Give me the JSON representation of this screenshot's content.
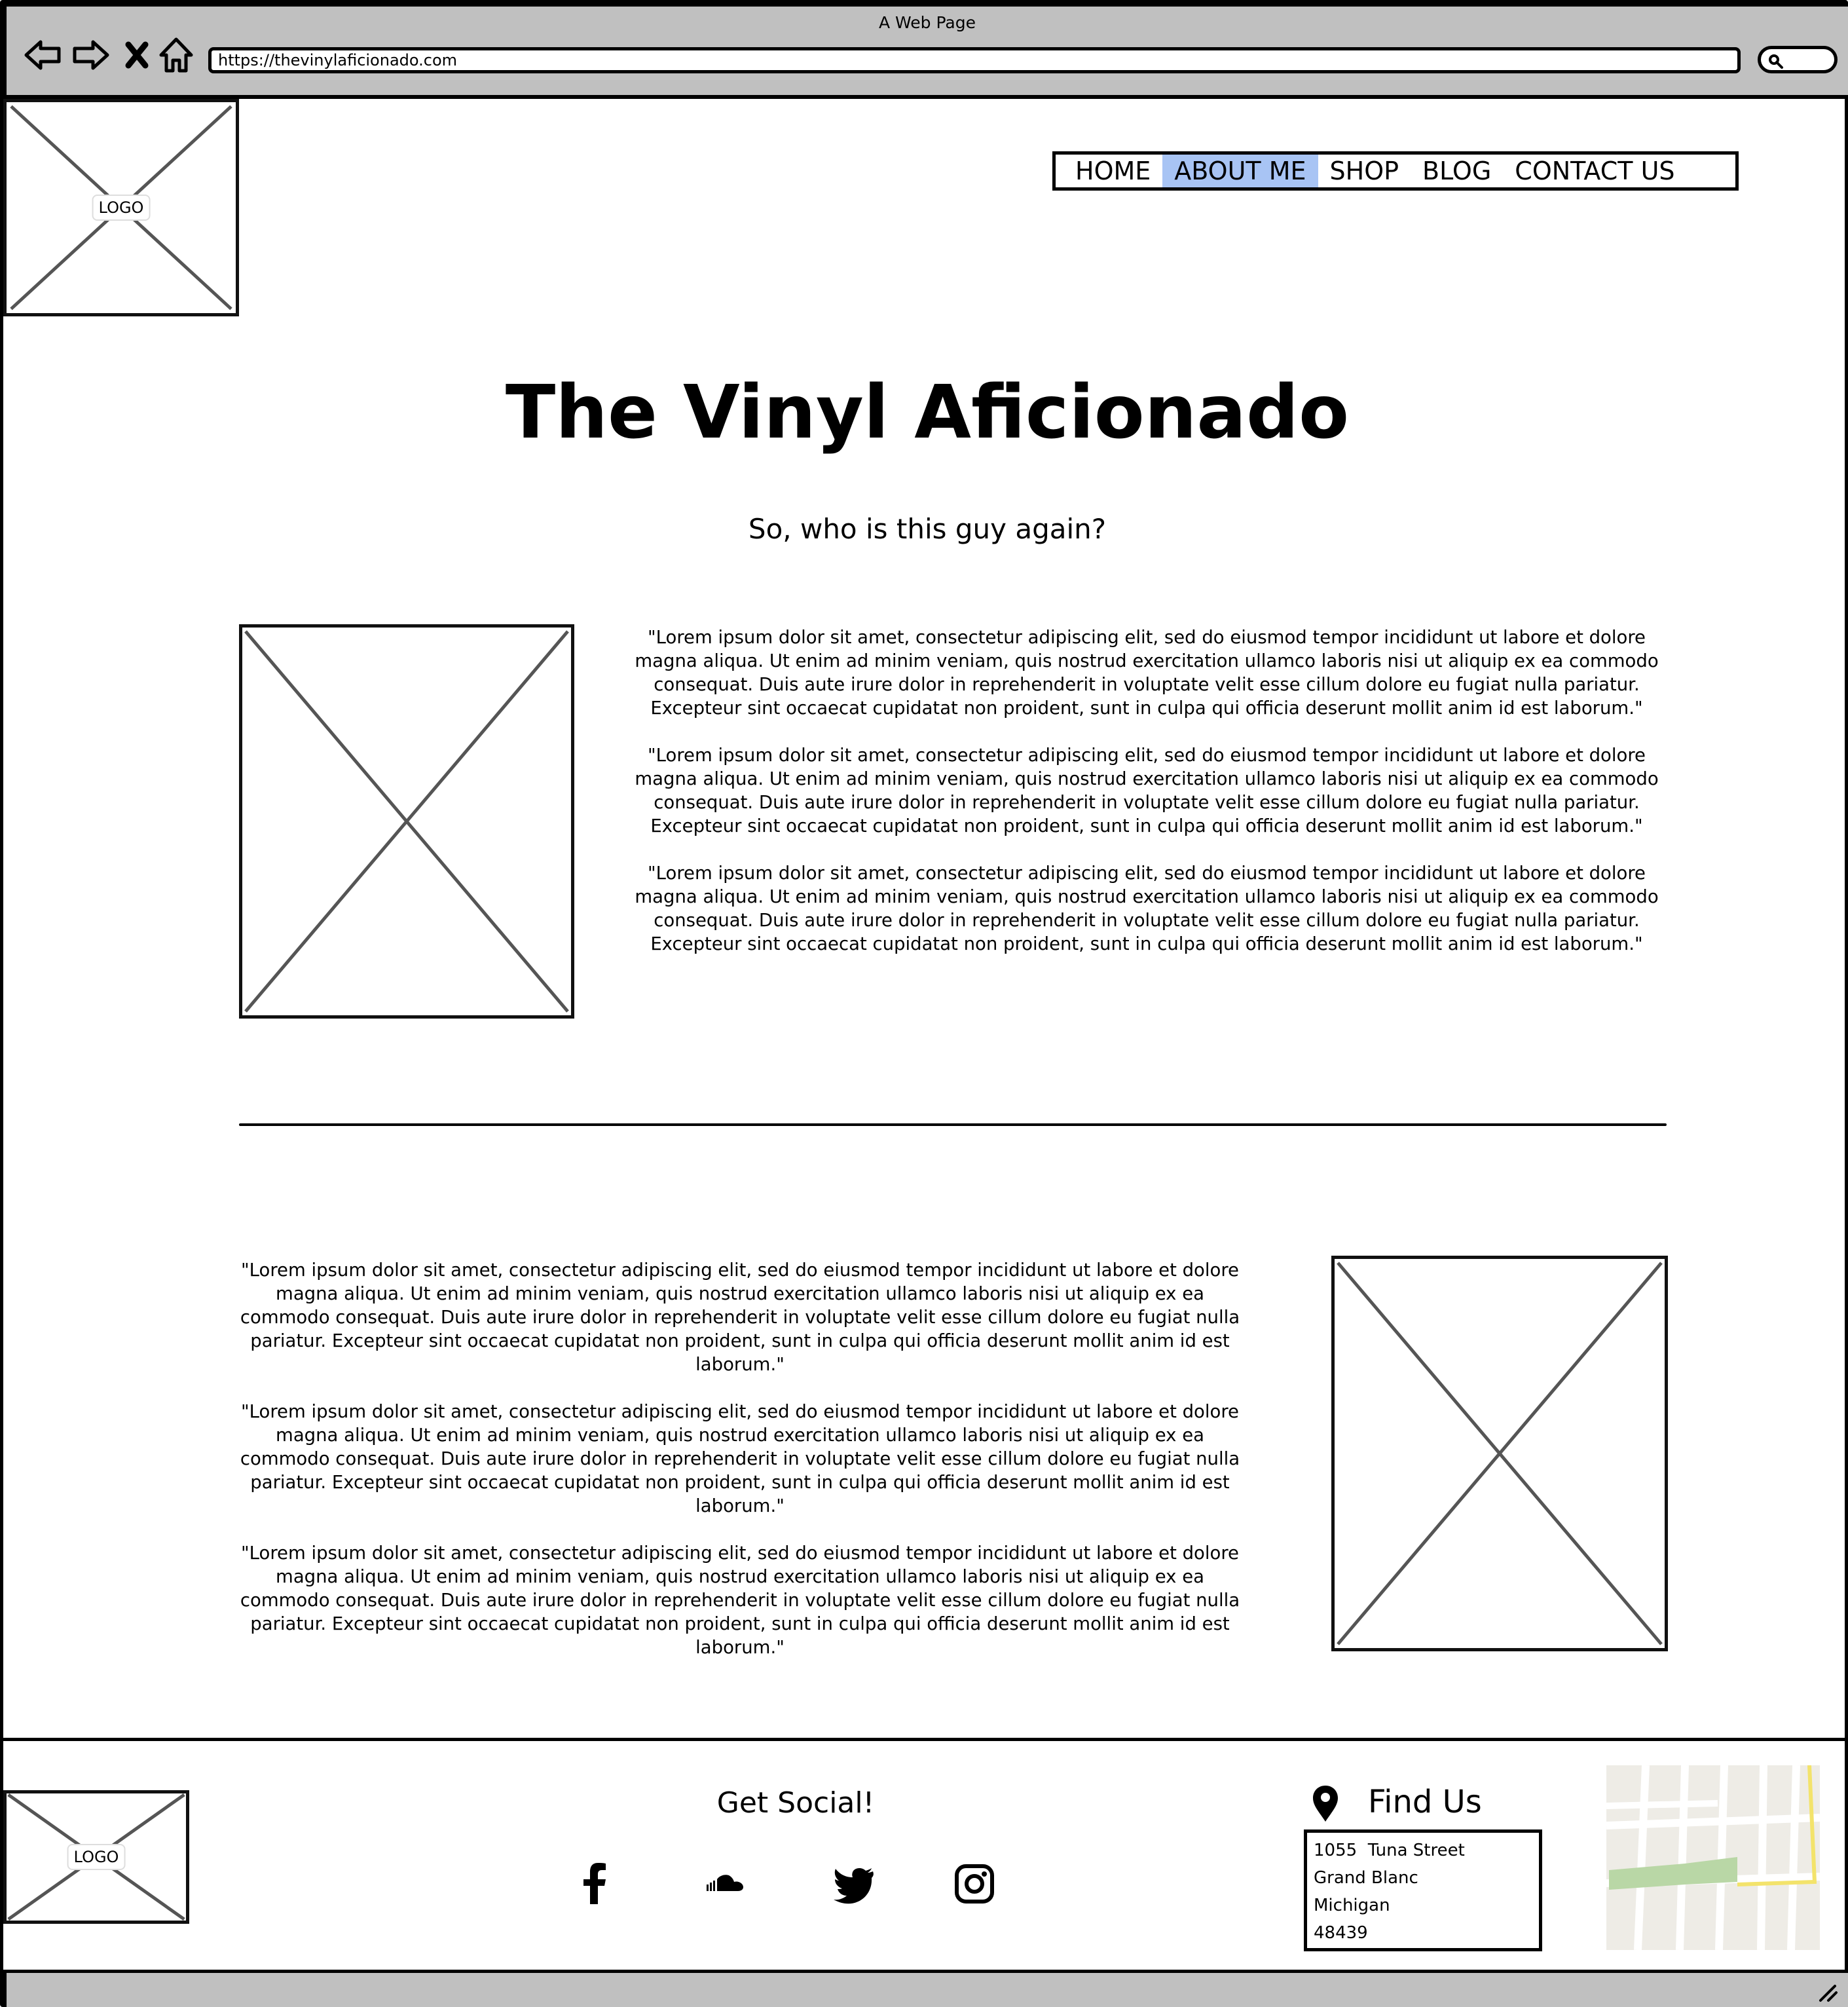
{
  "browser": {
    "window_title": "A Web Page",
    "url": "https://thevinylaficionado.com"
  },
  "header": {
    "logo_label": "LOGO"
  },
  "nav": {
    "items": [
      {
        "label": "HOME",
        "active": false
      },
      {
        "label": "ABOUT ME",
        "active": true
      },
      {
        "label": "SHOP",
        "active": false
      },
      {
        "label": "BLOG",
        "active": false
      },
      {
        "label": "CONTACT US",
        "active": false
      }
    ],
    "active_color": "#a8c4f4"
  },
  "main": {
    "title": "The Vinyl Aficionado",
    "subtitle": "So, who is this guy again?",
    "section1": {
      "paragraphs": [
        "\"Lorem ipsum dolor sit amet, consectetur adipiscing elit, sed do eiusmod tempor incididunt ut labore et dolore magna aliqua. Ut enim ad minim veniam, quis nostrud exercitation ullamco laboris nisi ut aliquip ex ea commodo consequat. Duis aute irure dolor in reprehenderit in voluptate velit esse cillum dolore eu fugiat nulla pariatur. Excepteur sint occaecat cupidatat non proident, sunt in culpa qui officia deserunt mollit anim id est laborum.\"",
        "\"Lorem ipsum dolor sit amet, consectetur adipiscing elit, sed do eiusmod tempor incididunt ut labore et dolore magna aliqua. Ut enim ad minim veniam, quis nostrud exercitation ullamco laboris nisi ut aliquip ex ea commodo consequat. Duis aute irure dolor in reprehenderit in voluptate velit esse cillum dolore eu fugiat nulla pariatur. Excepteur sint occaecat cupidatat non proident, sunt in culpa qui officia deserunt mollit anim id est laborum.\"",
        "\"Lorem ipsum dolor sit amet, consectetur adipiscing elit, sed do eiusmod tempor incididunt ut labore et dolore magna aliqua. Ut enim ad minim veniam, quis nostrud exercitation ullamco laboris nisi ut aliquip ex ea commodo consequat. Duis aute irure dolor in reprehenderit in voluptate velit esse cillum dolore eu fugiat nulla pariatur. Excepteur sint occaecat cupidatat non proident, sunt in culpa qui officia deserunt mollit anim id est laborum.\""
      ]
    },
    "section2": {
      "paragraphs": [
        "\"Lorem ipsum dolor sit amet, consectetur adipiscing elit, sed do eiusmod tempor incididunt ut labore et dolore magna aliqua. Ut enim ad minim veniam, quis nostrud exercitation ullamco laboris nisi ut aliquip ex ea commodo consequat. Duis aute irure dolor in reprehenderit in voluptate velit esse cillum dolore eu fugiat nulla pariatur. Excepteur sint occaecat cupidatat non proident, sunt in culpa qui officia deserunt mollit anim id est laborum.\"",
        "\"Lorem ipsum dolor sit amet, consectetur adipiscing elit, sed do eiusmod tempor incididunt ut labore et dolore magna aliqua. Ut enim ad minim veniam, quis nostrud exercitation ullamco laboris nisi ut aliquip ex ea commodo consequat. Duis aute irure dolor in reprehenderit in voluptate velit esse cillum dolore eu fugiat nulla pariatur. Excepteur sint occaecat cupidatat non proident, sunt in culpa qui officia deserunt mollit anim id est laborum.\"",
        "\"Lorem ipsum dolor sit amet, consectetur adipiscing elit, sed do eiusmod tempor incididunt ut labore et dolore magna aliqua. Ut enim ad minim veniam, quis nostrud exercitation ullamco laboris nisi ut aliquip ex ea commodo consequat. Duis aute irure dolor in reprehenderit in voluptate velit esse cillum dolore eu fugiat nulla pariatur. Excepteur sint occaecat cupidatat non proident, sunt in culpa qui officia deserunt mollit anim id est laborum.\""
      ]
    }
  },
  "footer": {
    "logo_label": "LOGO",
    "social_heading": "Get Social!",
    "social_icons": [
      "facebook-icon",
      "soundcloud-icon",
      "twitter-icon",
      "instagram-icon"
    ],
    "find_us_heading": "Find Us",
    "address": {
      "line1": "1055  Tuna Street",
      "line2": "Grand Blanc",
      "line3": "Michigan",
      "line4": "48439"
    },
    "map_colors": {
      "land": "#eeece6",
      "road": "#ffffff",
      "park": "#b9d7a6",
      "highway": "#f3e36b"
    }
  }
}
